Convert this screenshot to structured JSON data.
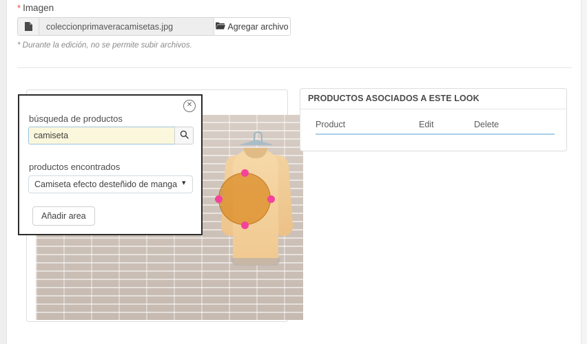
{
  "form": {
    "image_field": {
      "label": "Imagen",
      "required_marker": "*",
      "file_icon": "file-icon",
      "file_name": "coleccionprimaveracamisetas.jpg",
      "add_file_button": "Agregar archivo",
      "add_file_icon": "folder-open-icon",
      "help_note": "* Durante la edición, no se permite subir archivos."
    }
  },
  "modal": {
    "close_icon": "close-circle-icon",
    "search_label": "búsqueda de productos",
    "search_value": "camiseta",
    "search_placeholder": "",
    "search_icon": "search-icon",
    "found_label": "productos encontrados",
    "selected_product": "Camiseta efecto desteñido de manga corta",
    "select_arrow_icon": "chevron-updown-icon",
    "add_area_button": "Añadir area"
  },
  "image_editor": {
    "photo_alt": "camiseta-colgada-en-pared-de-ladrillo",
    "selection_shape": "circle",
    "handle_color": "#f4439a",
    "selection_fill": "#d67d0c"
  },
  "associated_panel": {
    "title": "PRODUCTOS ASOCIADOS A ESTE LOOK",
    "columns": [
      "Product",
      "Edit",
      "Delete"
    ],
    "rows": []
  },
  "colors": {
    "accent_border": "#a9cfe8",
    "required": "#e8483a",
    "input_focus_bg": "#fbf7dc",
    "panel_border": "#dddddd"
  }
}
